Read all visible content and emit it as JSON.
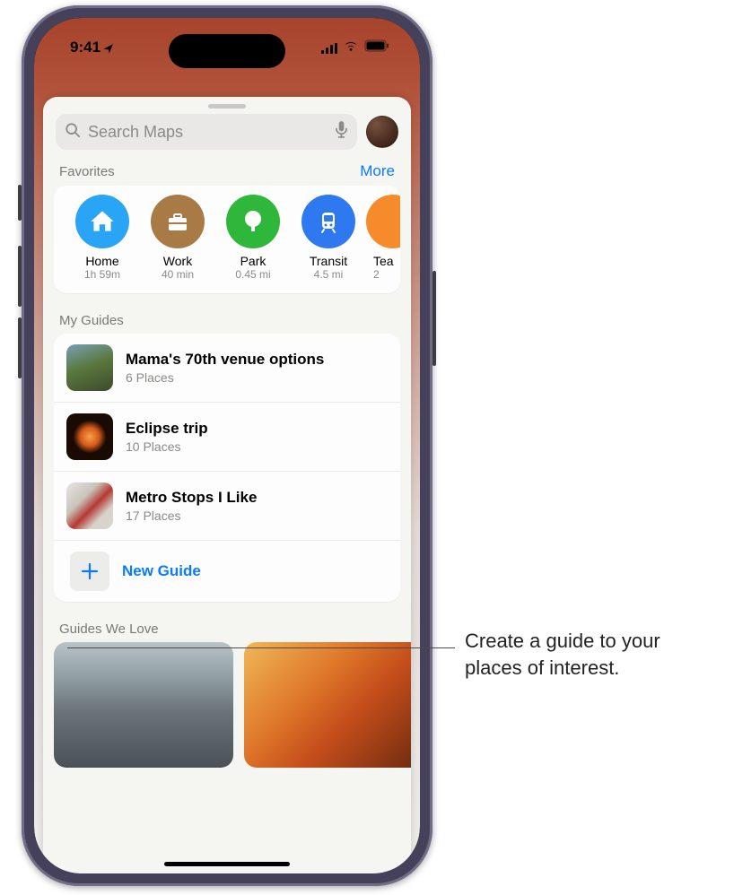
{
  "status": {
    "time": "9:41"
  },
  "search": {
    "placeholder": "Search Maps"
  },
  "favorites": {
    "header": "Favorites",
    "more": "More",
    "items": [
      {
        "label": "Home",
        "sub": "1h 59m",
        "color": "#2aa4f4",
        "icon": "home"
      },
      {
        "label": "Work",
        "sub": "40 min",
        "color": "#a87a45",
        "icon": "briefcase"
      },
      {
        "label": "Park",
        "sub": "0.45 mi",
        "color": "#2fb73c",
        "icon": "tree"
      },
      {
        "label": "Transit",
        "sub": "4.5 mi",
        "color": "#2e78f0",
        "icon": "transit"
      },
      {
        "label": "Tea",
        "sub": "2",
        "color": "#f68b2c",
        "icon": "cup"
      }
    ]
  },
  "my_guides": {
    "header": "My Guides",
    "items": [
      {
        "title": "Mama's 70th venue options",
        "sub": "6 Places"
      },
      {
        "title": "Eclipse trip",
        "sub": "10 Places"
      },
      {
        "title": "Metro Stops I Like",
        "sub": "17 Places"
      }
    ],
    "new_guide_label": "New Guide"
  },
  "guides_love": {
    "header": "Guides We Love"
  },
  "callout": {
    "text": "Create a guide to your places of interest."
  }
}
